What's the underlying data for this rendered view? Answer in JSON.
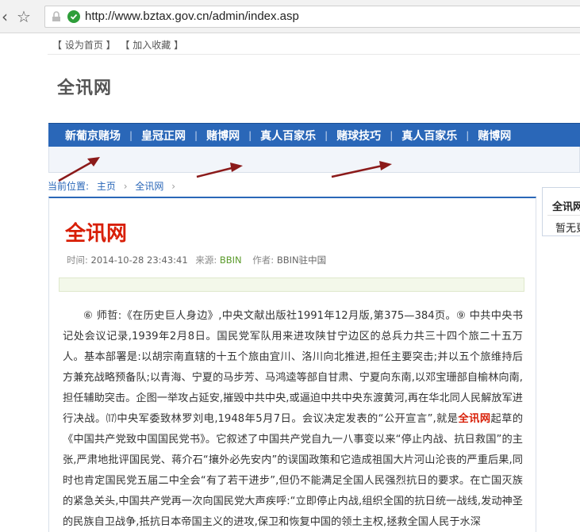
{
  "browser": {
    "url": "http://www.bztax.gov.cn/admin/index.asp"
  },
  "toplinks": [
    "【 设为首页 】",
    "【 加入收藏 】"
  ],
  "site": {
    "title": "全讯网"
  },
  "nav": {
    "items": [
      "新葡京赌场",
      "皇冠正网",
      "赌博网",
      "真人百家乐",
      "赌球技巧",
      "真人百家乐",
      "赌博网"
    ]
  },
  "breadcrumb": {
    "label": "当前位置:",
    "home": "主页",
    "current": "全讯网"
  },
  "article": {
    "title": "全讯网",
    "time_label": "时间:",
    "time": "2014-10-28 23:43:41",
    "source_label": "来源:",
    "source": "BBIN",
    "author_label": "作者:",
    "author": "BBIN驻中国",
    "body_pre": "⑥ 师哲:《在历史巨人身边》,中央文献出版社1991年12月版,第375—384页。⑨ 中共中央书记处会议记录,1939年2月8日。国民党军队用来进攻陕甘宁边区的总兵力共三十四个旅二十五万人。基本部署是:以胡宗南直辖的十五个旅由宜川、洛川向北推进,担任主要突击;并以五个旅维持后方兼充战略预备队;以青海、宁夏的马步芳、马鸿逵等部自甘肃、宁夏向东南,以邓宝珊部自榆林向南,担任辅助突击。企图一举攻占延安,摧毁中共中央,或逼迫中共中央东渡黄河,再在华北同人民解放军进行决战。⒄中央军委致林罗刘电,1948年5月7日。会议决定发表的“公开宣言”,就是",
    "body_highlight": "全讯网",
    "body_post": "起草的《中国共产党致中国国民党书》。它叙述了中国共产党自九一八事变以来“停止内战、抗日救国”的主张,严肃地批评国民党、蒋介石“攘外必先安内”的误国政策和它造成祖国大片河山沦丧的严重后果,同时也肯定国民党五届二中全会“有了若干进步”,但仍不能满足全国人民强烈抗日的要求。在亡国灭族的紧急关头,中国共产党再一次向国民党大声疾呼:“立即停止内战,组织全国的抗日统一战线,发动神圣的民族自卫战争,抵抗日本帝国主义的进攻,保卫和恢复中国的领土主权,拯救全国人民于水深"
  },
  "sidebar": {
    "heading": "全讯网",
    "text": "暂无更"
  },
  "colors": {
    "nav_bg": "#2a67b8",
    "title_red": "#d81e06",
    "arrow": "#8b1a1a"
  }
}
